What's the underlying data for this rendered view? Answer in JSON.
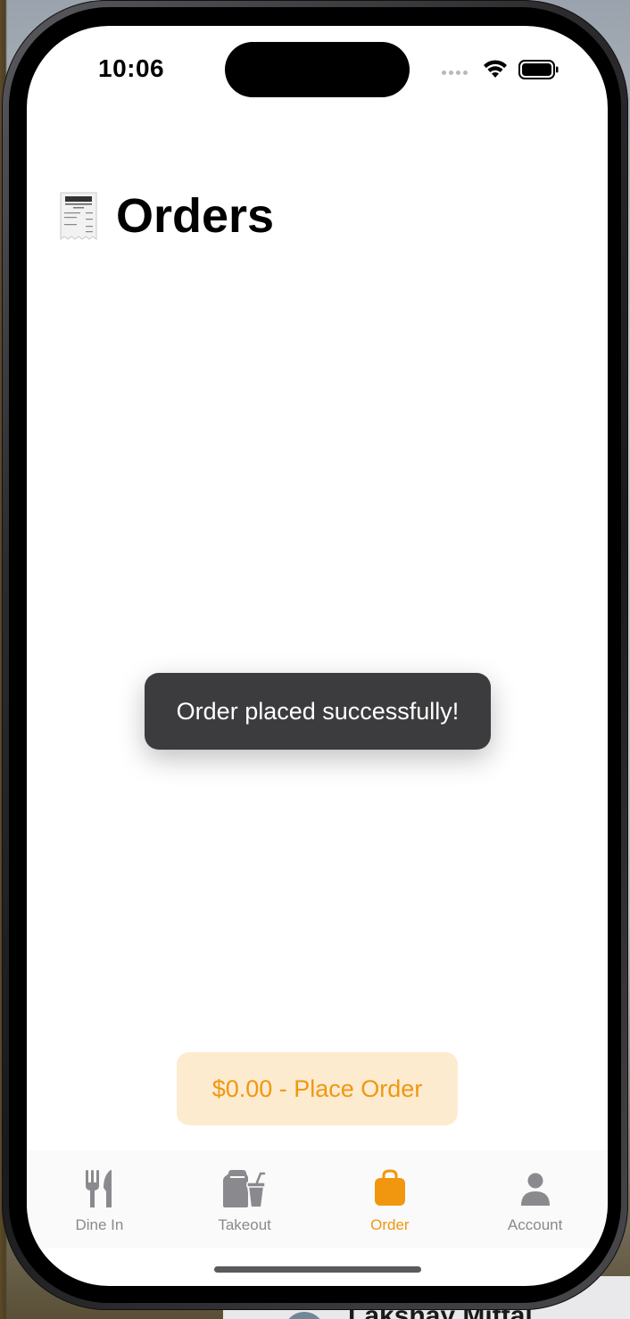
{
  "status_bar": {
    "time": "10:06"
  },
  "page": {
    "title": "Orders",
    "title_icon": "receipt-icon"
  },
  "toast": {
    "message": "Order placed successfully!"
  },
  "place_order_button": {
    "label": "$0.00 - Place Order"
  },
  "tab_bar": {
    "tabs": [
      {
        "label": "Dine In",
        "icon": "fork-knife-icon",
        "active": false
      },
      {
        "label": "Takeout",
        "icon": "takeout-bag-cup-icon",
        "active": false
      },
      {
        "label": "Order",
        "icon": "bag-icon",
        "active": true
      },
      {
        "label": "Account",
        "icon": "person-icon",
        "active": false
      }
    ]
  },
  "background": {
    "partial_name": "Lakshay Mittal"
  },
  "colors": {
    "accent": "#f0970f",
    "accent_light": "#fdebd0",
    "inactive_tab": "#8a8a8e",
    "toast_bg": "#3c3c3e"
  }
}
